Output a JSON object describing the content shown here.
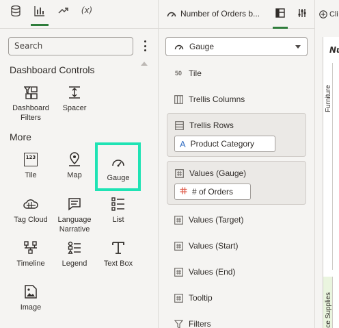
{
  "left_panel": {
    "tabs": [
      {
        "icon": "database-icon",
        "active": false
      },
      {
        "icon": "bar-chart-icon",
        "active": true
      },
      {
        "icon": "trend-icon",
        "active": false
      },
      {
        "label": "(x)",
        "active": false
      }
    ],
    "search_placeholder": "Search",
    "sections": {
      "dashboard_controls": "Dashboard Controls",
      "more": "More"
    },
    "tools": {
      "dashboard_filters": "Dashboard Filters",
      "spacer": "Spacer",
      "tile": "Tile",
      "map": "Map",
      "gauge": "Gauge",
      "tag_cloud": "Tag Cloud",
      "language_narrative": "Language Narrative",
      "list": "List",
      "timeline": "Timeline",
      "legend": "Legend",
      "text_box": "Text Box",
      "image": "Image",
      "tile_icon_text": "123"
    },
    "highlighted_tool": "Gauge",
    "highlight_color": "#1fe3b4"
  },
  "middle_panel": {
    "title": "Number of Orders b...",
    "viz_type": "Gauge",
    "grammar": {
      "tile": "Tile",
      "tile_icon_text": "50",
      "trellis_columns": "Trellis Columns",
      "trellis_rows": "Trellis Rows",
      "trellis_rows_value": "Product Category",
      "values_gauge": "Values (Gauge)",
      "values_gauge_value": "# of Orders",
      "values_target": "Values (Target)",
      "values_start": "Values (Start)",
      "values_end": "Values (End)",
      "tooltip": "Tooltip",
      "filters": "Filters"
    }
  },
  "right_panel": {
    "tab_label": "Cli",
    "canvas_title": "Nu",
    "categories": [
      "Furniture",
      "Office Supplies"
    ],
    "category_colors": [
      "#ffffff",
      "#eaf5df"
    ]
  },
  "colors": {
    "accent": "#2f7d3b",
    "measure_icon": "#e0604f",
    "attribute_icon": "#3a73c4"
  }
}
